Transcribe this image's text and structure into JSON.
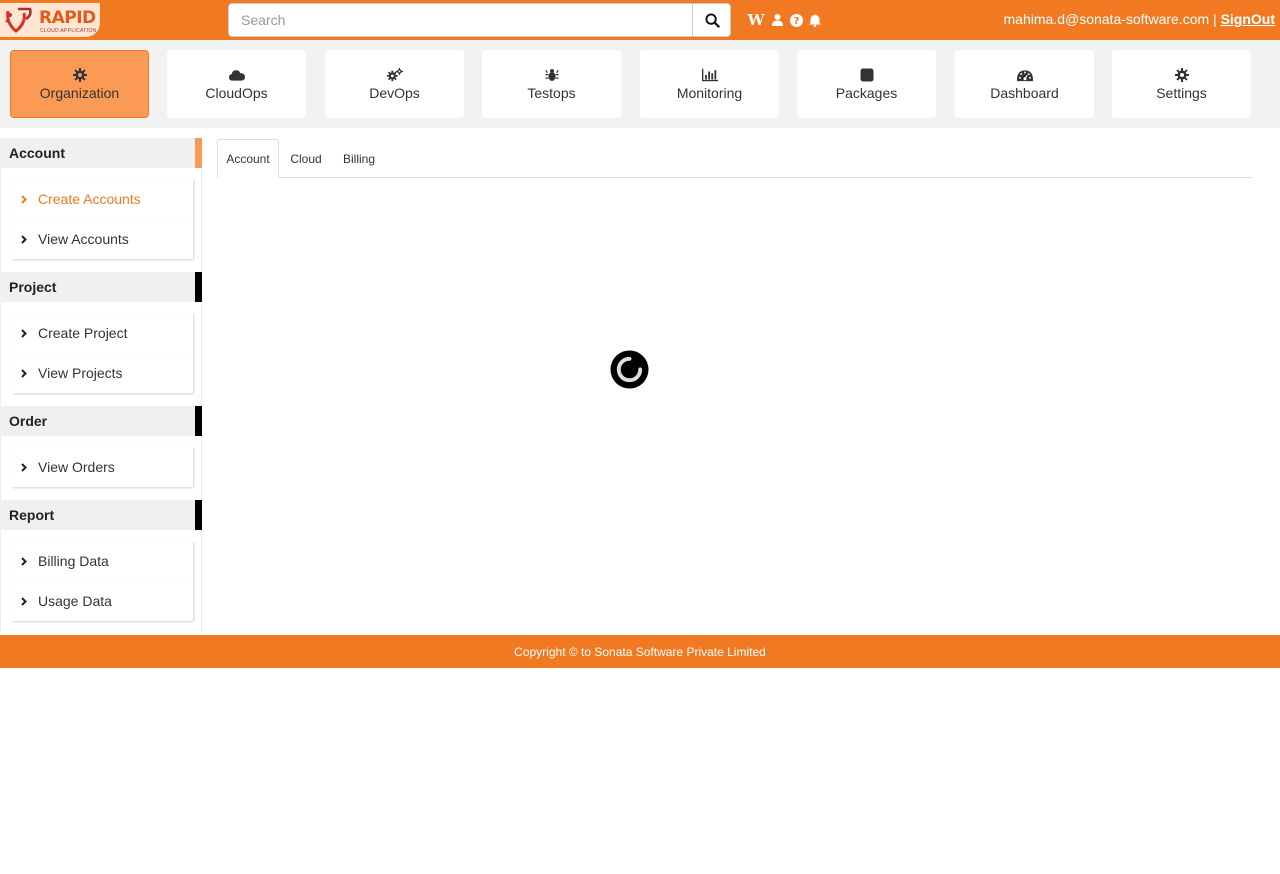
{
  "app": {
    "logo_text": "RAPID",
    "logo_sub": "CLOUD APPLICATION"
  },
  "header": {
    "search_placeholder": "Search",
    "icons": [
      "search-icon",
      "wikipedia-icon",
      "user-icon",
      "help-icon",
      "bell-icon"
    ],
    "user_email": "mahima.d@sonata-software.com",
    "separator": "|",
    "signout_label": "SignOut"
  },
  "nav": {
    "tiles": [
      {
        "label": "Organization",
        "icon": "gear-icon",
        "active": true
      },
      {
        "label": "CloudOps",
        "icon": "cloud-icon"
      },
      {
        "label": "DevOps",
        "icon": "cogs-icon"
      },
      {
        "label": "Testops",
        "icon": "bug-icon"
      },
      {
        "label": "Monitoring",
        "icon": "bar-chart-icon"
      },
      {
        "label": "Packages",
        "icon": "package-icon"
      },
      {
        "label": "Dashboard",
        "icon": "dashboard-icon"
      },
      {
        "label": "Settings",
        "icon": "settings-icon"
      }
    ]
  },
  "sidebar": {
    "sections": [
      {
        "title": "Account",
        "items": [
          "Create Accounts",
          "View Accounts"
        ]
      },
      {
        "title": "Project",
        "items": [
          "Create Project",
          "View Projects"
        ]
      },
      {
        "title": "Order",
        "items": [
          "View Orders"
        ]
      },
      {
        "title": "Report",
        "items": [
          "Billing Data",
          "Usage Data"
        ]
      }
    ],
    "active_item": "Create Accounts"
  },
  "main": {
    "tabs": [
      "Account",
      "Cloud",
      "Billing"
    ],
    "active_tab": "Account"
  },
  "footer": {
    "text": "Copyright © to Sonata Software Private Limited"
  },
  "colors": {
    "brand_orange": "#f07922",
    "active_tile": "#fa9a55",
    "sidebar_active_text": "#f07922"
  }
}
